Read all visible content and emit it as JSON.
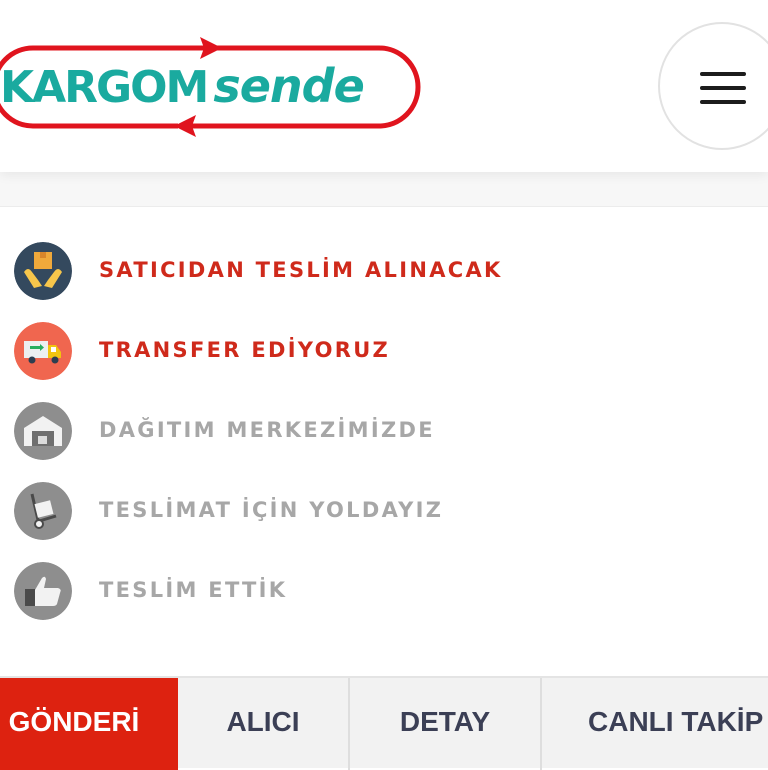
{
  "header": {
    "logo": {
      "main": "KARGOM",
      "sub": "sende",
      "colors": {
        "text": "#1aaa9f",
        "frame": "#e0141e"
      }
    },
    "menu_icon": "hamburger-menu-icon"
  },
  "steps": [
    {
      "label": "SATICIDAN TESLİM ALINACAK",
      "icon": "hands-box-icon",
      "status": "active"
    },
    {
      "label": "TRANSFER EDİYORUZ",
      "icon": "delivery-truck-icon",
      "status": "active"
    },
    {
      "label": "DAĞITIM MERKEZİMİZDE",
      "icon": "warehouse-icon",
      "status": "inactive"
    },
    {
      "label": "TESLİMAT İÇİN YOLDAYIZ",
      "icon": "hand-truck-icon",
      "status": "inactive"
    },
    {
      "label": "TESLİM ETTİK",
      "icon": "thumbs-up-icon",
      "status": "inactive"
    }
  ],
  "tabs": [
    {
      "label": "GÖNDERİ",
      "active": true
    },
    {
      "label": "ALICI",
      "active": false
    },
    {
      "label": "DETAY",
      "active": false
    },
    {
      "label": "CANLI TAKİP",
      "active": false
    }
  ],
  "colors": {
    "active_text": "#cf2a1b",
    "inactive_text": "#a7a7a7",
    "active_tab": "#dd2210",
    "tab_text": "#3b3f55"
  }
}
